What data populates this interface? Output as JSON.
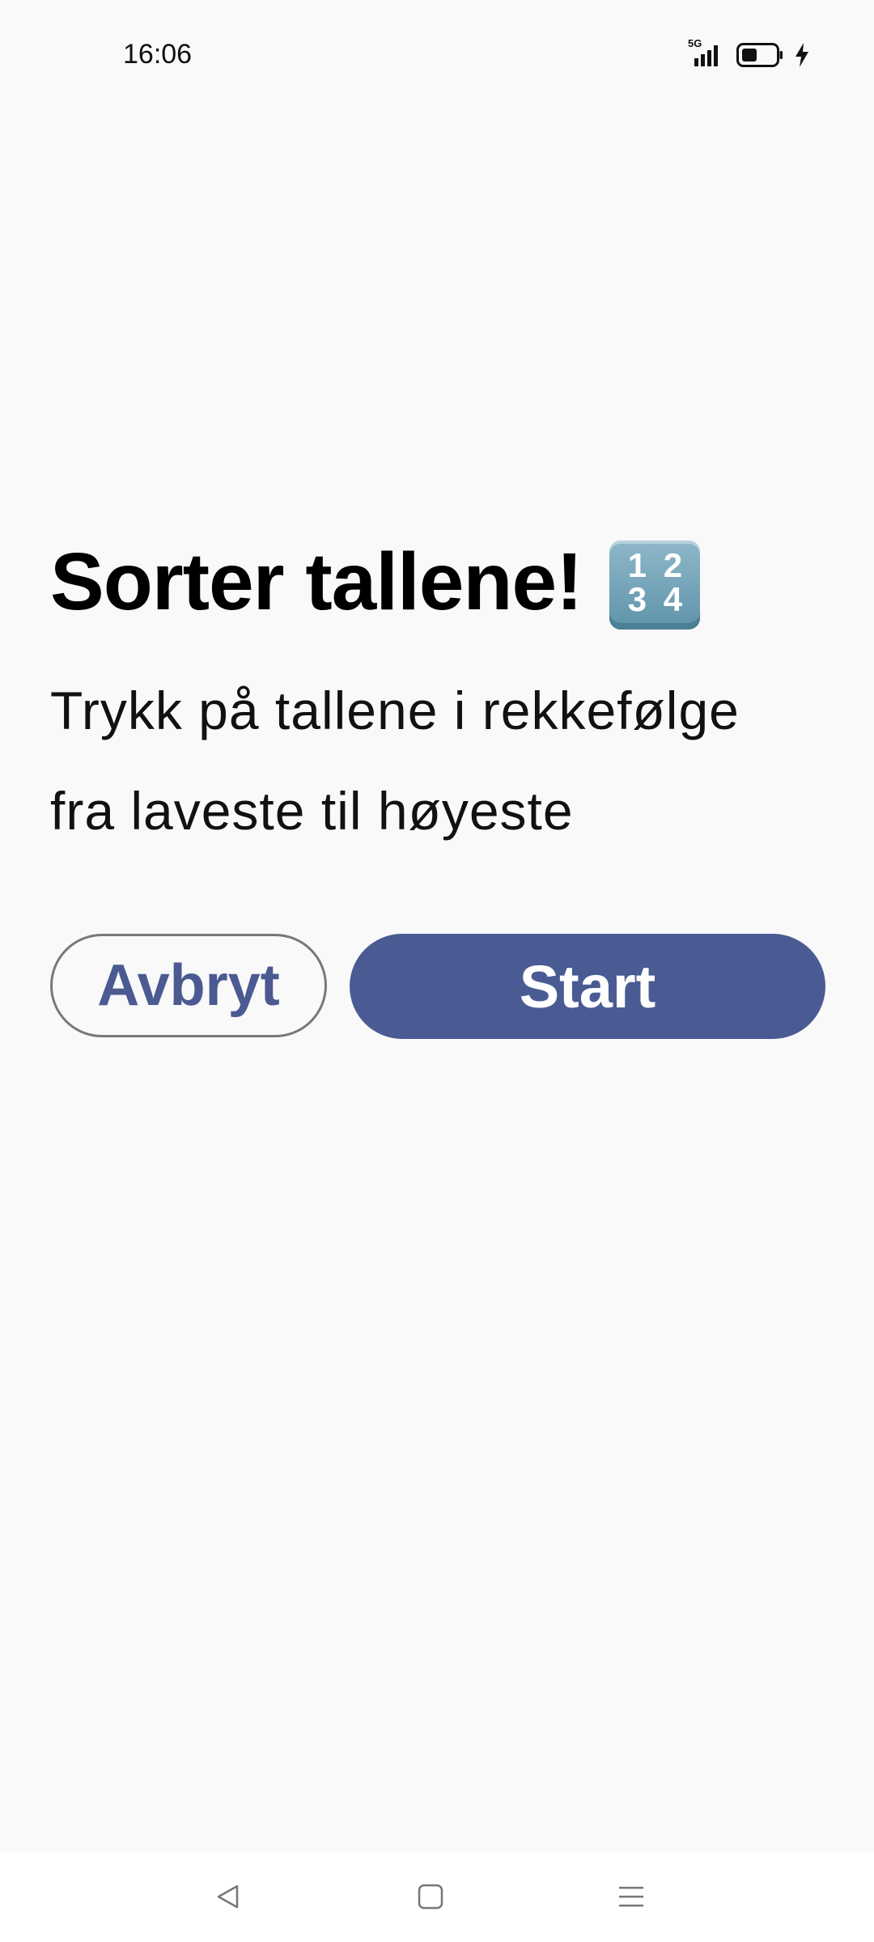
{
  "status_bar": {
    "time": "16:06",
    "network": "5G",
    "icons": [
      "signal-icon",
      "battery-icon",
      "charging-icon"
    ]
  },
  "main": {
    "title": "Sorter tallene!",
    "title_emoji_digits": [
      "1",
      "2",
      "3",
      "4"
    ],
    "subtitle_line1": "Trykk på tallene i rekkefølge",
    "subtitle_line2": "fra laveste til høyeste",
    "cancel_label": "Avbryt",
    "start_label": "Start"
  },
  "nav_bar": {
    "items": [
      "back-icon",
      "home-icon",
      "recents-icon"
    ]
  },
  "colors": {
    "background": "#f9f9fa",
    "accent": "#4a5b93",
    "cancel_text": "#4b5a91",
    "cancel_border": "#787878"
  }
}
